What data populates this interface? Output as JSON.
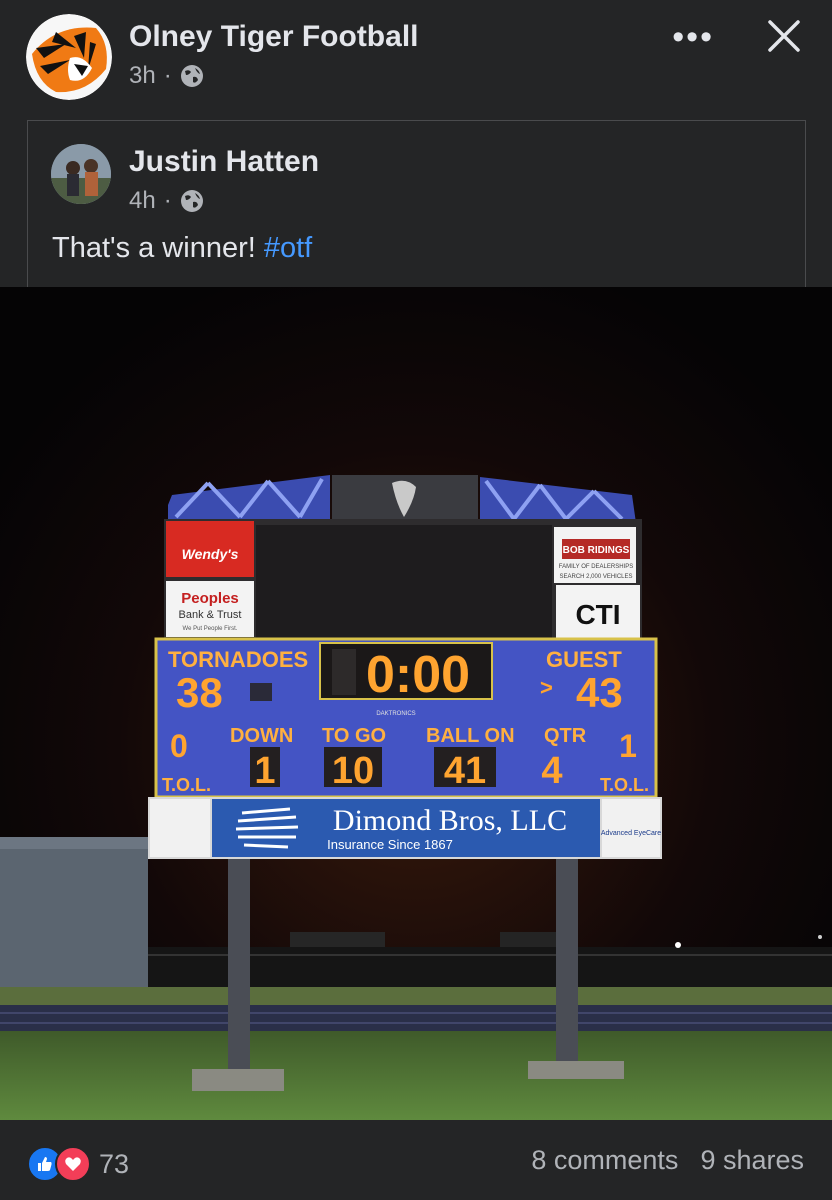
{
  "header": {
    "page_name": "Olney Tiger Football",
    "time": "3h",
    "more_label": "•••"
  },
  "shared_post": {
    "author": "Justin Hatten",
    "time": "4h",
    "text": "That's a winner! ",
    "hashtag": "#otf"
  },
  "scoreboard": {
    "home_label": "TORNADOES",
    "home_score": "38",
    "clock": "0:00",
    "guest_label": "GUEST",
    "guest_score": "43",
    "possession_marker": ">",
    "home_tol_value": "0",
    "down_label": "DOWN",
    "down": "1",
    "to_go_label": "TO GO",
    "to_go": "10",
    "ball_on_label": "BALL ON",
    "ball_on": "41",
    "qtr_label": "QTR",
    "quarter": "4",
    "guest_tol_value": "1",
    "tol_label": "T.O.L.",
    "maker": "DAKTRONICS",
    "sponsors": {
      "wendys": "Wendy's",
      "peoples_top": "Peoples",
      "peoples_bottom": "Bank & Trust",
      "peoples_tagline": "We Put People First.",
      "bob_ridings": "BOB RIDINGS",
      "bob_sub": "FAMILY OF DEALERSHIPS",
      "bob_search": "SEARCH 2,000 VEHICLES",
      "cti": "CTI",
      "dimond": "Dimond Bros, LLC",
      "dimond_sub": "Insurance Since 1867",
      "eyecare": "Advanced EyeCare"
    }
  },
  "footer": {
    "reaction_count": "73",
    "comments": "8 comments",
    "shares": "9 shares"
  },
  "colors": {
    "background": "#242526",
    "hashtag": "#4599ff",
    "like_blue": "#1877f2",
    "love_red": "#f33e58",
    "led_orange": "#ff9a2a"
  },
  "icons": [
    "tiger-logo-icon",
    "globe-icon",
    "more-icon",
    "close-icon",
    "like-icon",
    "love-icon"
  ]
}
